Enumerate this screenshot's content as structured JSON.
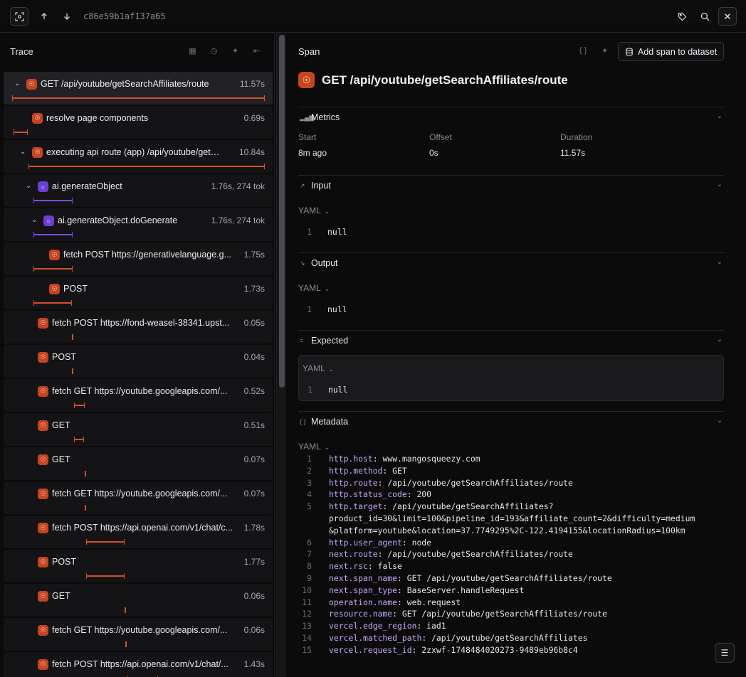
{
  "topbar": {
    "span_id": "c86e59b1af137a65",
    "icons": [
      "focus-icon",
      "arrow-up-icon",
      "arrow-down-icon",
      "tag-icon",
      "search-icon",
      "close-icon"
    ]
  },
  "trace": {
    "title": "Trace",
    "rows": [
      {
        "name": "GET /api/youtube/getSearchAffiliates/route",
        "duration": "11.57s"
      },
      {
        "name": "resolve page components",
        "duration": "0.69s"
      },
      {
        "name": "executing api route (app) /api/youtube/getS...",
        "duration": "10.84s"
      },
      {
        "name": "ai.generateObject",
        "duration": "1.76s, 274 tok"
      },
      {
        "name": "ai.generateObject.doGenerate",
        "duration": "1.76s, 274 tok"
      },
      {
        "name": "fetch POST https://generativelanguage.g...",
        "duration": "1.75s"
      },
      {
        "name": "POST",
        "duration": "1.73s"
      },
      {
        "name": "fetch POST https://fond-weasel-38341.upst...",
        "duration": "0.05s"
      },
      {
        "name": "POST",
        "duration": "0.04s"
      },
      {
        "name": "fetch GET https://youtube.googleapis.com/...",
        "duration": "0.52s"
      },
      {
        "name": "GET",
        "duration": "0.51s"
      },
      {
        "name": "GET",
        "duration": "0.07s"
      },
      {
        "name": "fetch GET https://youtube.googleapis.com/...",
        "duration": "0.07s"
      },
      {
        "name": "fetch POST https://api.openai.com/v1/chat/c...",
        "duration": "1.78s"
      },
      {
        "name": "POST",
        "duration": "1.77s"
      },
      {
        "name": "GET",
        "duration": "0.06s"
      },
      {
        "name": "fetch GET https://youtube.googleapis.com/...",
        "duration": "0.06s"
      },
      {
        "name": "fetch POST https://api.openai.com/v1/chat/...",
        "duration": "1.43s"
      }
    ]
  },
  "span": {
    "title": "Span",
    "add_button": "Add span to dataset",
    "name": "GET /api/youtube/getSearchAffiliates/route",
    "metrics": {
      "label": "Metrics",
      "start_label": "Start",
      "start_value": "8m ago",
      "offset_label": "Offset",
      "offset_value": "0s",
      "duration_label": "Duration",
      "duration_value": "11.57s"
    },
    "input": {
      "label": "Input",
      "format": "YAML",
      "line_no": "1",
      "value": "null"
    },
    "output": {
      "label": "Output",
      "format": "YAML",
      "line_no": "1",
      "value": "null"
    },
    "expected": {
      "label": "Expected",
      "format": "YAML",
      "line_no": "1",
      "value": "null"
    },
    "metadata": {
      "label": "Metadata",
      "format": "YAML",
      "lines": [
        {
          "n": "1",
          "k": "http.host",
          "v": ": www.mangosqueezy.com"
        },
        {
          "n": "2",
          "k": "http.method",
          "v": ": GET"
        },
        {
          "n": "3",
          "k": "http.route",
          "v": ": /api/youtube/getSearchAffiliates/route"
        },
        {
          "n": "4",
          "k": "http.status_code",
          "v": ": 200"
        },
        {
          "n": "5",
          "k": "http.target",
          "v": ": /api/youtube/getSearchAffiliates?"
        },
        {
          "n": "",
          "k": "",
          "v": "product_id=30&limit=100&pipeline_id=193&affiliate_count=2&difficulty=medium"
        },
        {
          "n": "",
          "k": "",
          "v": "&platform=youtube&location=37.7749295%2C-122.4194155&locationRadius=100km"
        },
        {
          "n": "6",
          "k": "http.user_agent",
          "v": ": node"
        },
        {
          "n": "7",
          "k": "next.route",
          "v": ": /api/youtube/getSearchAffiliates/route"
        },
        {
          "n": "8",
          "k": "next.rsc",
          "v": ": false"
        },
        {
          "n": "9",
          "k": "next.span_name",
          "v": ": GET /api/youtube/getSearchAffiliates/route"
        },
        {
          "n": "10",
          "k": "next.span_type",
          "v": ": BaseServer.handleRequest"
        },
        {
          "n": "11",
          "k": "operation.name",
          "v": ": web.request"
        },
        {
          "n": "12",
          "k": "resource.name",
          "v": ": GET /api/youtube/getSearchAffiliates/route"
        },
        {
          "n": "13",
          "k": "vercel.edge_region",
          "v": ": iad1"
        },
        {
          "n": "14",
          "k": "vercel.matched_path",
          "v": ": /api/youtube/getSearchAffiliates"
        },
        {
          "n": "15",
          "k": "vercel.request_id",
          "v": ": 2zxwf-1748484020273-9489eb96b8c4"
        }
      ]
    }
  }
}
